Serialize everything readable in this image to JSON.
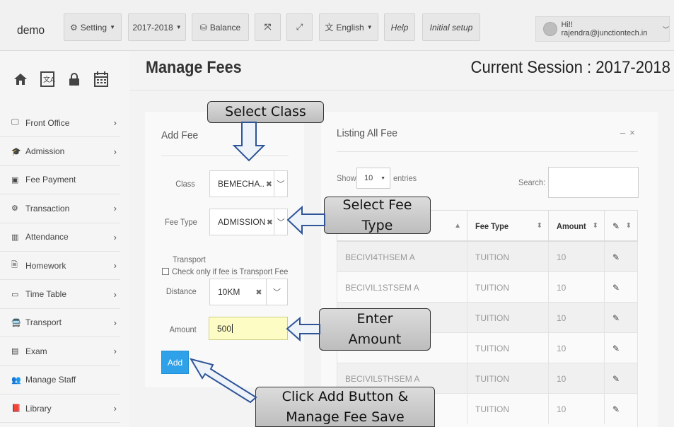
{
  "header": {
    "brand": "demo",
    "setting": "Setting",
    "year": "2017-2018",
    "balance": "Balance",
    "language": "English",
    "help": "Help",
    "initial_setup": "Initial setup",
    "user": "Hi!! rajendra@junctiontech.in"
  },
  "sidebar": {
    "items": [
      {
        "label": "Front Office",
        "icon": "monitor-icon"
      },
      {
        "label": "Admission",
        "icon": "graduation-cap-icon"
      },
      {
        "label": "Fee Payment",
        "icon": "money-icon"
      },
      {
        "label": "Transaction",
        "icon": "gear-icon"
      },
      {
        "label": "Attendance",
        "icon": "bar-chart-icon"
      },
      {
        "label": "Homework",
        "icon": "document-icon"
      },
      {
        "label": "Time Table",
        "icon": "calendar-icon"
      },
      {
        "label": "Transport",
        "icon": "bus-icon"
      },
      {
        "label": "Exam",
        "icon": "file-icon"
      },
      {
        "label": "Manage Staff",
        "icon": "users-icon"
      },
      {
        "label": "Library",
        "icon": "book-icon"
      }
    ]
  },
  "main": {
    "title": "Manage Fees",
    "session": "Current Session : 2017-2018"
  },
  "add_fee": {
    "title": "Add Fee",
    "class_label": "Class",
    "class_value": "BEMECHA..",
    "fee_type_label": "Fee Type",
    "fee_type_value": "ADMISSION",
    "transport_label": "Transport",
    "transport_check_label": "Check only if fee is Transport Fee",
    "distance_label": "Distance",
    "distance_value": "10KM",
    "amount_label": "Amount",
    "amount_value": "500",
    "add_button": "Add"
  },
  "listing": {
    "title": "Listing All Fee",
    "show_label": "Show",
    "entries_value": "10",
    "entries_label": "entries",
    "search_label": "Search:",
    "columns": [
      "Fee Type",
      "Amount"
    ],
    "rows": [
      {
        "class": "BECIVI4THSEM A",
        "fee_type": "TUITION",
        "amount": "10"
      },
      {
        "class": "BECIVIL1STSEM A",
        "fee_type": "TUITION",
        "amount": "10"
      },
      {
        "class": "",
        "fee_type": "TUITION",
        "amount": "10"
      },
      {
        "class": "",
        "fee_type": "TUITION",
        "amount": "10"
      },
      {
        "class": "BECIVIL5THSEM A",
        "fee_type": "TUITION",
        "amount": "10"
      },
      {
        "class": "",
        "fee_type": "TUITION",
        "amount": "10"
      }
    ]
  },
  "callouts": {
    "select_class": "Select Class",
    "select_fee_type_1": "Select Fee",
    "select_fee_type_2": "Type",
    "enter_amount_1": "Enter",
    "enter_amount_2": "Amount",
    "click_add_1": "Click Add Button &",
    "click_add_2": "Manage Fee Save"
  }
}
